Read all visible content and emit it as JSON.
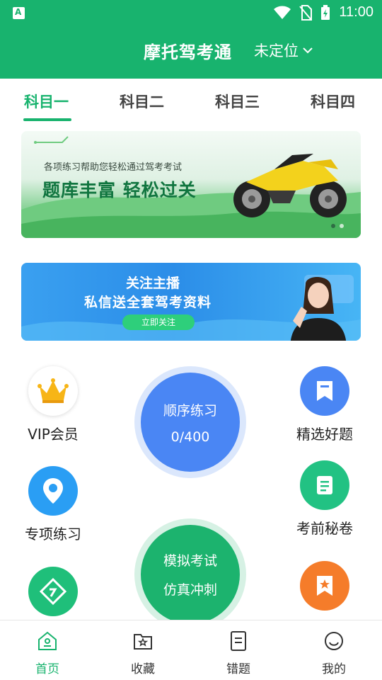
{
  "status_bar": {
    "time": "11:00"
  },
  "header": {
    "title": "摩托驾考通",
    "location": "未定位"
  },
  "tabs": [
    {
      "label": "科目一",
      "active": true
    },
    {
      "label": "科目二",
      "active": false
    },
    {
      "label": "科目三",
      "active": false
    },
    {
      "label": "科目四",
      "active": false
    }
  ],
  "banner1": {
    "subtitle": "各项练习帮助您轻松通过驾考考试",
    "headline": "题库丰富  轻松过关"
  },
  "banner2": {
    "line1": "关注主播",
    "line2": "私信送全套驾考资料",
    "button": "立即关注"
  },
  "features": {
    "vip": {
      "label": "VIP会员"
    },
    "special": {
      "label": "专项练习"
    },
    "selected": {
      "label": "精选好题"
    },
    "secret": {
      "label": "考前秘卷"
    }
  },
  "sequential": {
    "title": "顺序练习",
    "progress": "0/400"
  },
  "mock": {
    "title": "模拟考试",
    "subtitle": "仿真冲刺"
  },
  "bottom_nav": [
    {
      "label": "首页",
      "active": true
    },
    {
      "label": "收藏",
      "active": false
    },
    {
      "label": "错题",
      "active": false
    },
    {
      "label": "我的",
      "active": false
    }
  ],
  "colors": {
    "brand": "#18b36e",
    "blue": "#4a86f4",
    "orange": "#f57c2a"
  }
}
